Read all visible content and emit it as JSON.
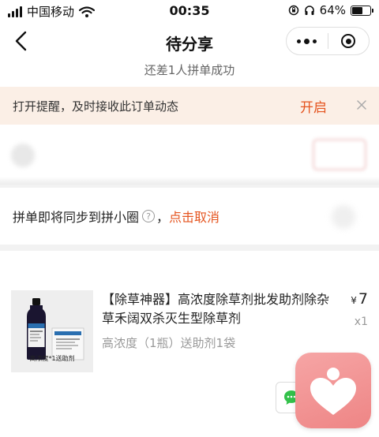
{
  "status_bar": {
    "carrier": "中国移动",
    "time": "00:35",
    "battery_percent": "64%",
    "battery_level": 0.64
  },
  "header": {
    "title": "待分享",
    "subtitle": "还差1人拼单成功"
  },
  "reminder": {
    "text": "打开提醒，及时接收此订单动态",
    "action_label": "开启"
  },
  "sync": {
    "text": "拼单即将同步到拼小圈",
    "help_symbol": "?",
    "separator": "，",
    "cancel_label": "点击取消"
  },
  "product": {
    "title": "【除草神器】高浓度除草剂批发助剂除杂草禾阔双杀灭生型除草剂",
    "spec": "高浓度（1瓶）送助剂1袋",
    "currency": "¥",
    "price": "7",
    "quantity": "x1",
    "image_caption": "高浓度*1送助剂"
  },
  "colors": {
    "accent": "#e5541f",
    "banner_bg": "#fbefe6",
    "app_icon": "#f09090"
  },
  "icons": {
    "back": "chevron-left-icon",
    "more": "more-dots-icon",
    "exit": "target-ring-icon",
    "close": "close-icon",
    "help": "question-circle-icon",
    "chat": "chat-bubble-icon",
    "app": "heart-person-icon"
  }
}
